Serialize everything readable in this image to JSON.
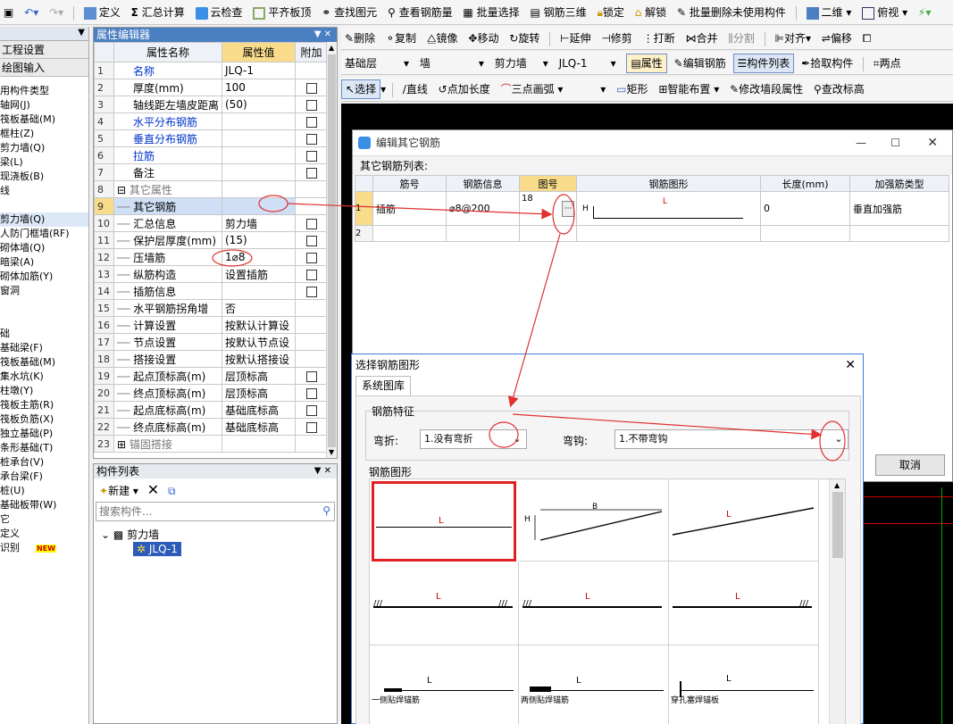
{
  "toolbar1": {
    "items": [
      "定义",
      "汇总计算",
      "云检查",
      "平齐板顶",
      "查找图元",
      "查看钢筋量",
      "批量选择",
      "钢筋三维",
      "锁定",
      "解锁",
      "批量删除未使用构件",
      "二维",
      "俯视"
    ]
  },
  "left_nav": {
    "buttons": [
      "工程设置",
      "绘图输入"
    ],
    "items": [
      "用构件类型",
      "轴网(J)",
      "筏板基础(M)",
      "框柱(Z)",
      "剪力墙(Q)",
      "梁(L)",
      "现浇板(B)",
      "线",
      "",
      "剪力墙(Q)",
      "人防门框墙(RF)",
      "砌体墙(Q)",
      "暗梁(A)",
      "砌体加筋(Y)",
      "窗洞",
      "",
      "",
      "础",
      "基础梁(F)",
      "筏板基础(M)",
      "集水坑(K)",
      "柱墩(Y)",
      "筏板主筋(R)",
      "筏板负筋(X)",
      "独立基础(P)",
      "条形基础(T)",
      "桩承台(V)",
      "承台梁(F)",
      "桩(U)",
      "基础板带(W)",
      "它",
      "定义",
      "识别"
    ],
    "new_badge": "NEW"
  },
  "prop_editor": {
    "title": "属性编辑器",
    "pin": "▼ ✕",
    "headers": [
      "属性名称",
      "属性值",
      "附加"
    ],
    "rows": [
      {
        "n": "1",
        "name": "名称",
        "value": "JLQ-1",
        "cb": false,
        "color": "blue"
      },
      {
        "n": "2",
        "name": "厚度(mm)",
        "value": "100",
        "cb": true,
        "color": "black"
      },
      {
        "n": "3",
        "name": "轴线距左墙皮距离",
        "value": "(50)",
        "cb": true,
        "color": "black"
      },
      {
        "n": "4",
        "name": "水平分布钢筋",
        "value": "",
        "cb": true,
        "color": "blue"
      },
      {
        "n": "5",
        "name": "垂直分布钢筋",
        "value": "",
        "cb": true,
        "color": "blue"
      },
      {
        "n": "6",
        "name": "拉筋",
        "value": "",
        "cb": true,
        "color": "blue"
      },
      {
        "n": "7",
        "name": "备注",
        "value": "",
        "cb": true,
        "color": "black"
      },
      {
        "n": "8",
        "name": "其它属性",
        "value": "",
        "cb": false,
        "color": "gray",
        "group": "−"
      },
      {
        "n": "9",
        "name": "其它钢筋",
        "value": "",
        "cb": false,
        "color": "black",
        "sel": true
      },
      {
        "n": "10",
        "name": "汇总信息",
        "value": "剪力墙",
        "cb": true,
        "color": "black"
      },
      {
        "n": "11",
        "name": "保护层厚度(mm)",
        "value": "(15)",
        "cb": true,
        "color": "black"
      },
      {
        "n": "12",
        "name": "压墙筋",
        "value": "1⌀8",
        "cb": true,
        "color": "black"
      },
      {
        "n": "13",
        "name": "纵筋构造",
        "value": "设置插筋",
        "cb": true,
        "color": "black"
      },
      {
        "n": "14",
        "name": "插筋信息",
        "value": "",
        "cb": true,
        "color": "black"
      },
      {
        "n": "15",
        "name": "水平钢筋拐角增",
        "value": "否",
        "cb": false,
        "color": "black"
      },
      {
        "n": "16",
        "name": "计算设置",
        "value": "按默认计算设",
        "cb": false,
        "color": "black"
      },
      {
        "n": "17",
        "name": "节点设置",
        "value": "按默认节点设",
        "cb": false,
        "color": "black"
      },
      {
        "n": "18",
        "name": "搭接设置",
        "value": "按默认搭接设",
        "cb": false,
        "color": "black"
      },
      {
        "n": "19",
        "name": "起点顶标高(m)",
        "value": "层顶标高",
        "cb": true,
        "color": "black"
      },
      {
        "n": "20",
        "name": "终点顶标高(m)",
        "value": "层顶标高",
        "cb": true,
        "color": "black"
      },
      {
        "n": "21",
        "name": "起点底标高(m)",
        "value": "基础底标高",
        "cb": true,
        "color": "black"
      },
      {
        "n": "22",
        "name": "终点底标高(m)",
        "value": "基础底标高",
        "cb": true,
        "color": "black"
      },
      {
        "n": "23",
        "name": "锚固搭接",
        "value": "",
        "cb": false,
        "color": "gray",
        "group": "+"
      }
    ]
  },
  "comp_list": {
    "title": "构件列表",
    "pin": "▼ ✕",
    "new_label": "新建",
    "search_placeholder": "搜索构件...",
    "tree_root": "剪力墙",
    "tree_child": "JLQ-1"
  },
  "toolbar_r1": {
    "items": [
      "删除",
      "复制",
      "镜像",
      "移动",
      "旋转",
      "延伸",
      "修剪",
      "打断",
      "合并",
      "分割",
      "对齐",
      "偏移",
      "两"
    ]
  },
  "toolbar_r2": {
    "floor": "基础层",
    "type": "墙",
    "sub": "剪力墙",
    "name": "JLQ-1",
    "items": [
      "属性",
      "编辑钢筋",
      "构件列表",
      "拾取构件",
      "两点"
    ]
  },
  "toolbar_r3": {
    "items": [
      "选择",
      "直线",
      "点加长度",
      "三点画弧",
      "矩形",
      "智能布置",
      "修改墙段属性",
      "查改标高"
    ]
  },
  "dlg_other": {
    "title": "编辑其它钢筋",
    "list_label": "其它钢筋列表:",
    "headers": [
      "筋号",
      "钢筋信息",
      "图号",
      "钢筋图形",
      "长度(mm)",
      "加强筋类型"
    ],
    "rows": [
      {
        "n": "1",
        "bar": "插筋",
        "info": "⌀8@200",
        "fig": "18",
        "len": "0",
        "type": "垂直加强筋"
      },
      {
        "n": "2",
        "bar": "",
        "info": "",
        "fig": "",
        "len": "",
        "type": ""
      }
    ],
    "shape_H": "H",
    "shape_L": "L",
    "ellipsis": "···",
    "cancel": "取消"
  },
  "dlg_select": {
    "title": "选择钢筋图形",
    "tab": "系统图库",
    "group_feature": "钢筋特征",
    "bend_label": "弯折:",
    "bend_value": "1.没有弯折",
    "hook_label": "弯钩:",
    "hook_value": "1.不带弯钩",
    "group_shape": "钢筋图形",
    "shape_labels": {
      "L": "L",
      "B": "B",
      "H": "H"
    },
    "captions": [
      "一侧贴焊锚筋",
      "两侧贴焊锚筋",
      "穿孔塞焊锚板"
    ]
  },
  "colors": {
    "accent": "#4a7fc1",
    "annotation": "#e03030",
    "selected_border": "#e02020"
  }
}
